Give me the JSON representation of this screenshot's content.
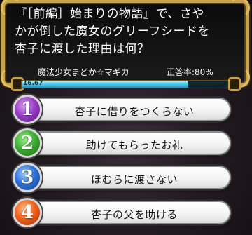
{
  "question": {
    "lines": [
      "『［前編］始まりの物語』で、さや",
      "かが倒した魔女のグリーフシードを",
      "杏子に渡した理由は何？"
    ],
    "category": "魔法少女まどか☆マギカ",
    "accuracy": "正答率:80%"
  },
  "timer": {
    "value": "16.67",
    "fill_fraction": 0.8,
    "fill_color": "#52c8e8"
  },
  "answers": [
    {
      "number": "1",
      "label": "杏子に借りをつくらない",
      "color": "#9a3fc8"
    },
    {
      "number": "2",
      "label": "助けてもらったお礼",
      "color": "#3fae35"
    },
    {
      "number": "3",
      "label": "ほむらに渡さない",
      "color": "#2f73d8"
    },
    {
      "number": "4",
      "label": "杏子の父を助ける",
      "color": "#f0621c"
    }
  ],
  "colors": {
    "frame_gold": "#c9a24a",
    "background": "#241c22"
  }
}
